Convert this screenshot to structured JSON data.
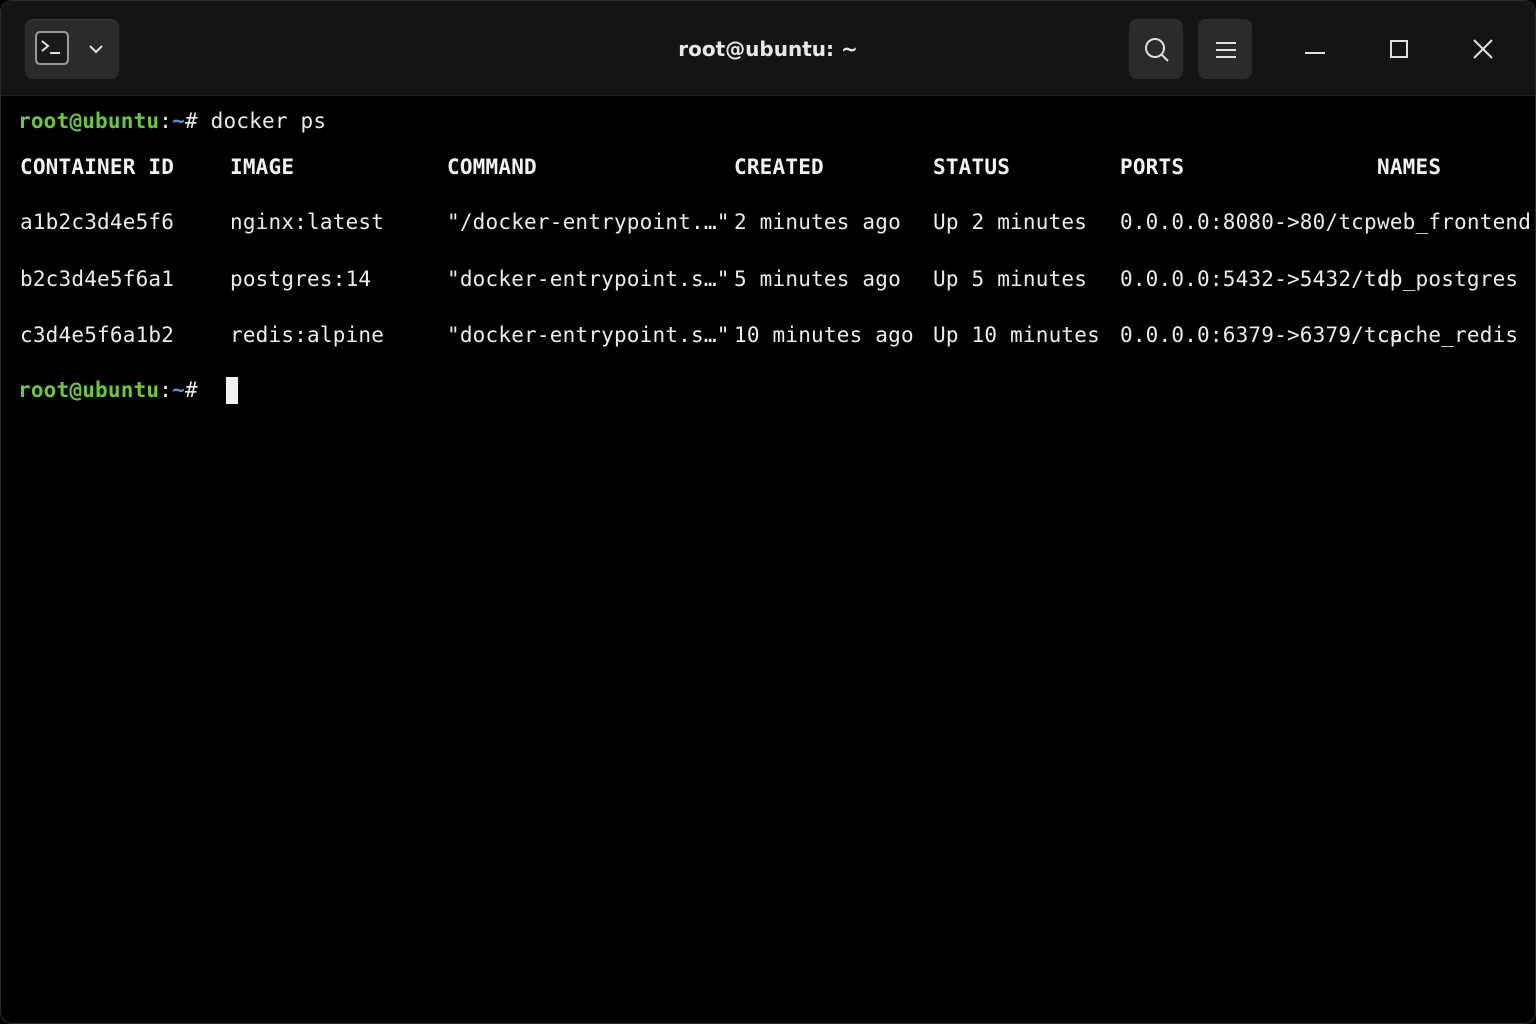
{
  "window": {
    "title": "root@ubuntu: ~"
  },
  "titlebar": {
    "tab_switcher_icon": "terminal-icon",
    "tab_switcher_dropdown_icon": "chevron-down-icon",
    "search_icon": "search-icon",
    "menu_icon": "hamburger-menu-icon",
    "minimize_icon": "minimize-icon",
    "maximize_icon": "maximize-icon",
    "close_icon": "close-icon"
  },
  "colors": {
    "prompt_user": "#6cc644",
    "prompt_path": "#5b8fd6",
    "text": "#ececec",
    "background": "#000000"
  },
  "prompt": {
    "user_host": "root@ubuntu",
    "colon": ":",
    "path": "~",
    "symbol": "#"
  },
  "command": "docker ps",
  "table": {
    "headers": [
      "CONTAINER ID",
      "IMAGE",
      "COMMAND",
      "CREATED",
      "STATUS",
      "PORTS",
      "NAMES"
    ],
    "rows": [
      [
        "a1b2c3d4e5f6",
        "nginx:latest",
        "\"/docker-entrypoint.…\"",
        "2 minutes ago",
        "Up 2 minutes",
        "0.0.0.0:8080->80/tcp",
        "web_frontend"
      ],
      [
        "b2c3d4e5f6a1",
        "postgres:14",
        "\"docker-entrypoint.s…\"",
        "5 minutes ago",
        "Up 5 minutes",
        "0.0.0.0:5432->5432/tcp",
        "db_postgres"
      ],
      [
        "c3d4e5f6a1b2",
        "redis:alpine",
        "\"docker-entrypoint.s…\"",
        "10 minutes ago",
        "Up 10 minutes",
        "0.0.0.0:6379->6379/tcp",
        "cache_redis"
      ]
    ]
  }
}
